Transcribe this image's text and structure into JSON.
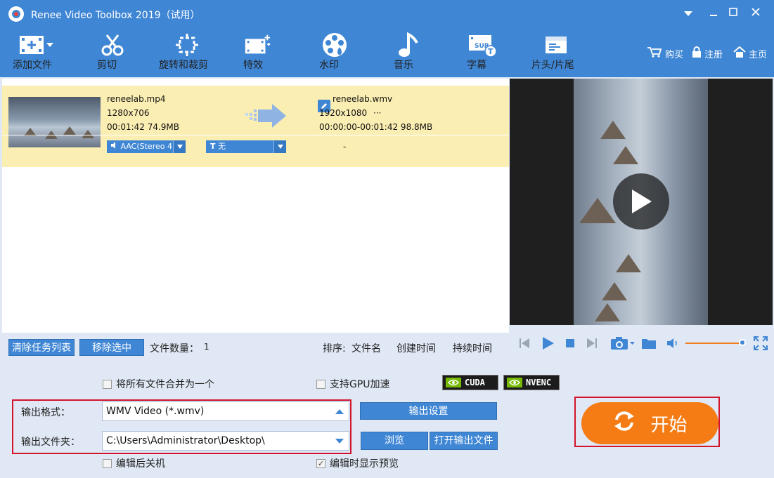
{
  "app": {
    "title": "Renee Video Toolbox 2019（试用）"
  },
  "toolbar": {
    "add_file": "添加文件",
    "cut": "剪切",
    "rotate_crop": "旋转和裁剪",
    "effects": "特效",
    "watermark": "水印",
    "music": "音乐",
    "subtitle": "字幕",
    "intro_outro": "片头/片尾",
    "buy": "购买",
    "register": "注册",
    "home": "主页"
  },
  "file": {
    "source": {
      "name": "reneelab.mp4",
      "resolution": "1280x706",
      "duration_size": "00:01:42  74.9MB"
    },
    "output": {
      "name": "reneelab.wmv",
      "resolution": "1920x1080",
      "more": "···",
      "range_size": "00:00:00-00:01:42  98.8MB"
    },
    "audio_track": "AAC(Stereo 4",
    "subtitle_track": "无",
    "dash": "-"
  },
  "tasks": {
    "clear_list": "清除任务列表",
    "remove_selected": "移除选中",
    "file_count_label": "文件数量：",
    "file_count": "1",
    "sort_label": "排序:",
    "sort_filename": "文件名",
    "sort_created": "创建时间",
    "sort_duration": "持续时间"
  },
  "options": {
    "merge_all": "将所有文件合并为一个",
    "gpu_accel": "支持GPU加速",
    "cuda": "CUDA",
    "nvenc": "NVENC",
    "shutdown_after": "编辑后关机",
    "show_preview": "编辑时显示预览"
  },
  "output": {
    "format_label": "输出格式：",
    "format_value": "WMV Video (*.wmv)",
    "folder_label": "输出文件夹：",
    "folder_value": "C:\\Users\\Administrator\\Desktop\\",
    "settings_button": "输出设置",
    "browse_button": "浏览",
    "open_folder_button": "打开输出文件"
  },
  "start": {
    "label": "开始"
  },
  "player": {
    "volume_level": 0.9
  },
  "colors": {
    "primary": "#3f86d4",
    "row_highlight": "#fbeeb3",
    "accent": "#f57c14",
    "highlight_border": "#d3142b"
  }
}
